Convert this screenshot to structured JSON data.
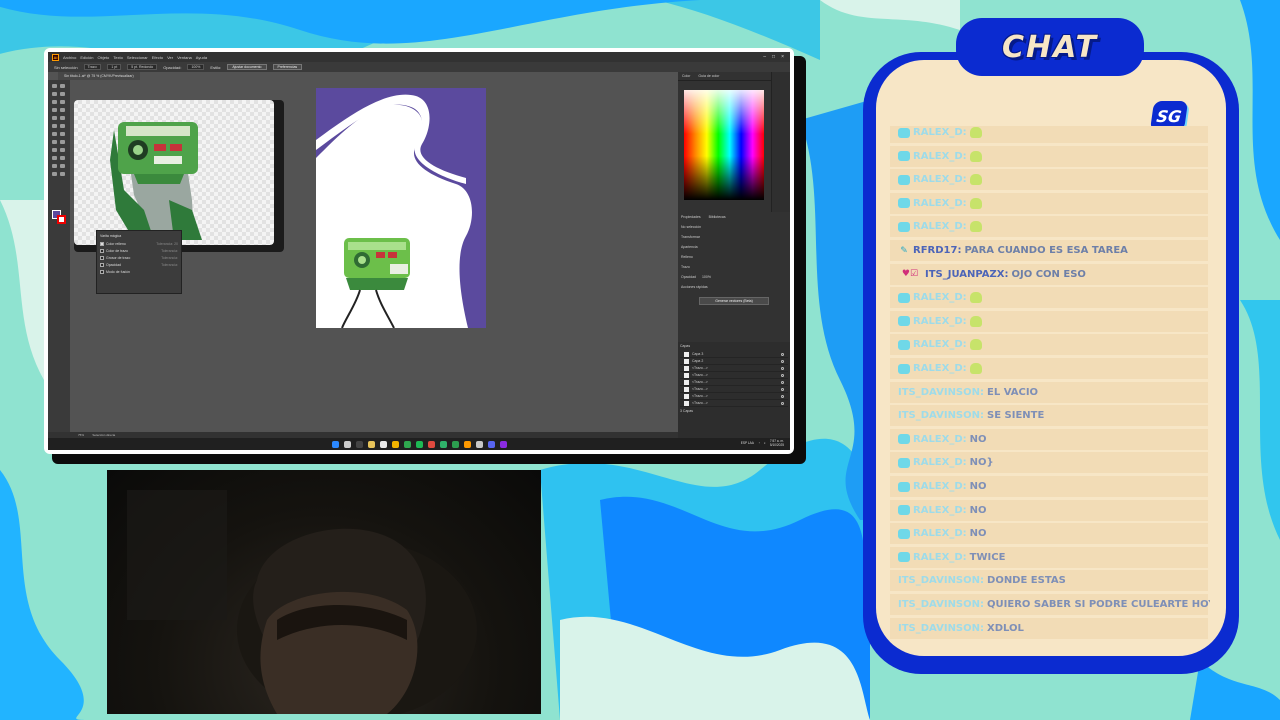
{
  "app": {
    "menu": [
      "Archivo",
      "Edición",
      "Objeto",
      "Texto",
      "Seleccionar",
      "Efecto",
      "Ver",
      "Ventana",
      "Ayuda"
    ],
    "no_selection": "Sin selección",
    "doc_tab": "Sin título-1.ai* @ 75 % (CMYK/Previsualizar)",
    "control": {
      "stroke_label": "Trazo:",
      "stroke_value": "1 pt",
      "style": "Uniforme",
      "stroke_style": "5 pt. Redondo",
      "opacity_label": "Opacidad:",
      "opacity_value": "100%",
      "style_label": "Estilo:",
      "doc_setup_button": "Ajustar documento",
      "prefs_button": "Preferencias"
    },
    "magic_wand": {
      "title": "Varita mágica",
      "rows": [
        {
          "label": "Color relleno",
          "value": "Tolerancia: 20",
          "checked": true
        },
        {
          "label": "Color de trazo",
          "value": "Tolerancia:",
          "checked": false
        },
        {
          "label": "Grosor de trazo",
          "value": "Tolerancia:",
          "checked": false
        },
        {
          "label": "Opacidad",
          "value": "Tolerancia:",
          "checked": false
        },
        {
          "label": "Modo de fusión",
          "value": "",
          "checked": false
        }
      ]
    },
    "color_panel": {
      "tabs": [
        "Color",
        "Guía de color"
      ]
    },
    "align_panel": {
      "tabs": [
        "Alinear",
        "Transformar"
      ]
    },
    "properties_panel": {
      "tabs": [
        "Propiedades",
        "Bibliotecas"
      ],
      "no_selection": "No selección",
      "transform": "Transformar",
      "appearance": "Apariencia",
      "fill": "Relleno",
      "stroke": "Trazo",
      "opacity": "Opacidad",
      "opacity_value": "100%",
      "quick_actions": "Acciones rápidas",
      "vectorize_button": "Generar vectores (Beta)"
    },
    "layers_panel": {
      "title": "Capas",
      "layers": [
        "Capa 3",
        "Capa 2",
        "<Trazo...>",
        "<Trazo...>",
        "<Trazo...>",
        "<Trazo...>",
        "<Trazo...>",
        "<Trazo...>"
      ],
      "footer": "3 Capas"
    },
    "status": {
      "zoom": "75%",
      "tool": "Selección directa"
    },
    "tray": {
      "lang": "ESP LAA",
      "time": "7:57 a. m.",
      "date": "5/10/2025"
    },
    "colors": {
      "artboard": "#5b4a9e",
      "robot": "#6cbf4a"
    }
  },
  "chat": {
    "title": "CHAT",
    "logo": "SG",
    "messages": [
      {
        "user": "RALEX_D:",
        "text": "",
        "emote": true,
        "badge": "SG",
        "partial": true
      },
      {
        "user": "RALEX_D:",
        "text": "",
        "emote": true,
        "badge": "SG"
      },
      {
        "user": "RALEX_D:",
        "text": "",
        "emote": true,
        "badge": "SG"
      },
      {
        "user": "RALEX_D:",
        "text": "",
        "emote": true,
        "badge": "SG"
      },
      {
        "user": "RALEX_D:",
        "text": "",
        "emote": true,
        "badge": "SG"
      },
      {
        "user": "RFRD17:",
        "text": "PARA CUANDO ES ESA TAREA",
        "emote": false,
        "badge": "✎",
        "dark": true
      },
      {
        "user": "ITS_JUANPAZX:",
        "text": "OJO CON ESO",
        "emote": false,
        "badge": "♥☑",
        "dark": true
      },
      {
        "user": "RALEX_D:",
        "text": "",
        "emote": true,
        "badge": "SG"
      },
      {
        "user": "RALEX_D:",
        "text": "",
        "emote": true,
        "badge": "SG"
      },
      {
        "user": "RALEX_D:",
        "text": "",
        "emote": true,
        "badge": "SG"
      },
      {
        "user": "RALEX_D:",
        "text": "",
        "emote": true,
        "badge": "SG"
      },
      {
        "user": "ITS_DAVINSON:",
        "text": "EL VACIO",
        "emote": false,
        "badge": ""
      },
      {
        "user": "ITS_DAVINSON:",
        "text": "SE SIENTE",
        "emote": false,
        "badge": ""
      },
      {
        "user": "RALEX_D:",
        "text": "NO",
        "emote": false,
        "badge": "SG"
      },
      {
        "user": "RALEX_D:",
        "text": "NO}",
        "emote": false,
        "badge": "SG"
      },
      {
        "user": "RALEX_D:",
        "text": "NO",
        "emote": false,
        "badge": "SG"
      },
      {
        "user": "RALEX_D:",
        "text": "NO",
        "emote": false,
        "badge": "SG"
      },
      {
        "user": "RALEX_D:",
        "text": "NO",
        "emote": false,
        "badge": "SG"
      },
      {
        "user": "RALEX_D:",
        "text": "TWICE",
        "emote": false,
        "badge": "SG"
      },
      {
        "user": "ITS_DAVINSON:",
        "text": "DONDE ESTAS",
        "emote": false,
        "badge": ""
      },
      {
        "user": "ITS_DAVINSON:",
        "text": "QUIERO SABER SI PODRE CULEARTE HOY",
        "emote": false,
        "badge": ""
      },
      {
        "user": "ITS_DAVINSON:",
        "text": "XDLOL",
        "emote": false,
        "badge": ""
      }
    ]
  }
}
